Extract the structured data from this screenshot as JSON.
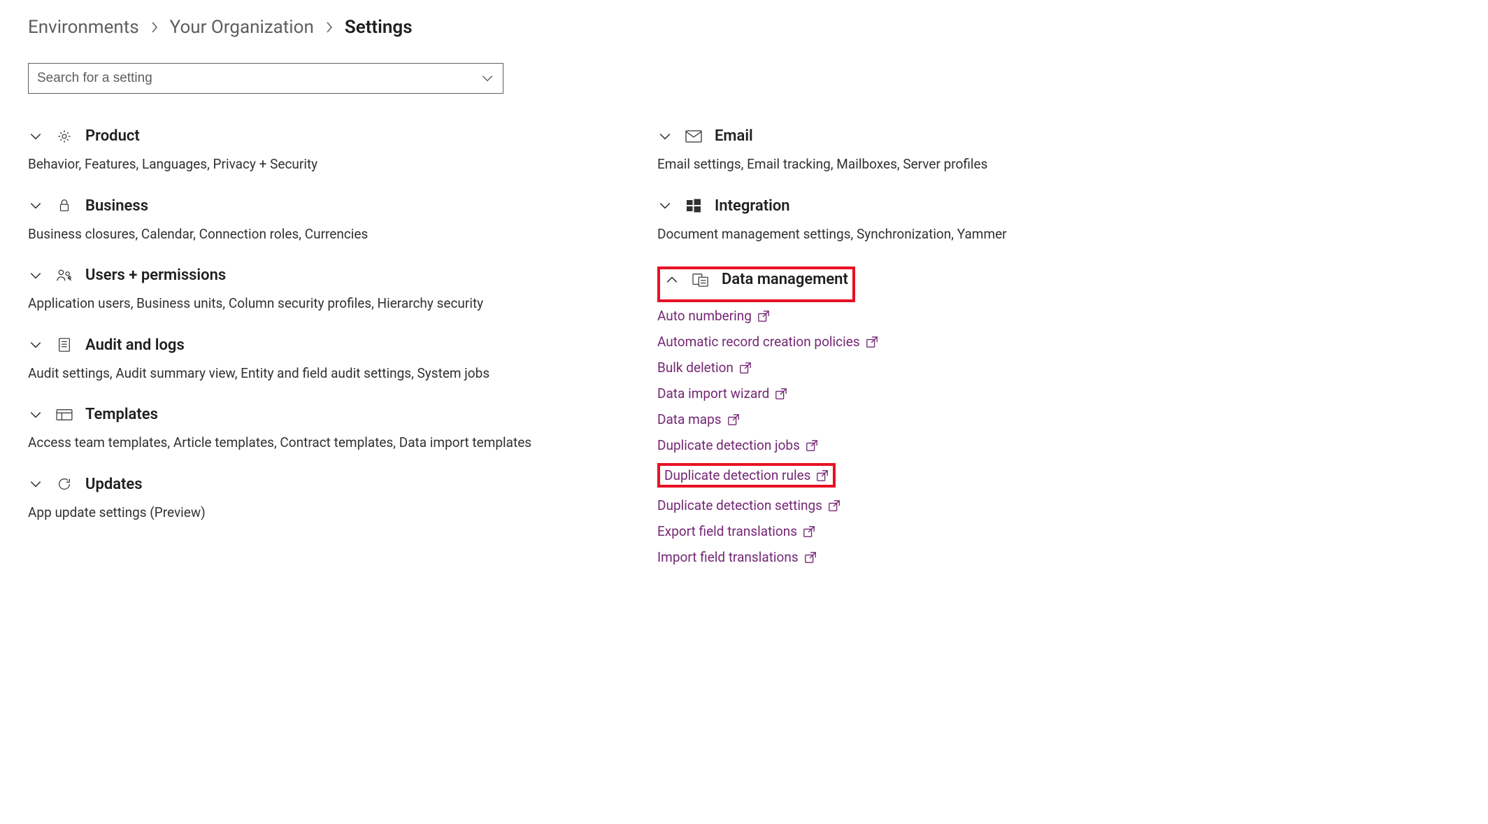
{
  "breadcrumb": {
    "items": [
      {
        "label": "Environments",
        "active": false
      },
      {
        "label": "Your Organization",
        "active": false
      },
      {
        "label": "Settings",
        "active": true
      }
    ]
  },
  "search": {
    "placeholder": "Search for a setting"
  },
  "left_categories": [
    {
      "icon": "gear",
      "title": "Product",
      "expanded": false,
      "description": "Behavior, Features, Languages, Privacy + Security"
    },
    {
      "icon": "lock",
      "title": "Business",
      "expanded": false,
      "description": "Business closures, Calendar, Connection roles, Currencies"
    },
    {
      "icon": "people",
      "title": "Users + permissions",
      "expanded": false,
      "description": "Application users, Business units, Column security profiles, Hierarchy security"
    },
    {
      "icon": "list",
      "title": "Audit and logs",
      "expanded": false,
      "description": "Audit settings, Audit summary view, Entity and field audit settings, System jobs"
    },
    {
      "icon": "templates",
      "title": "Templates",
      "expanded": false,
      "description": "Access team templates, Article templates, Contract templates, Data import templates"
    },
    {
      "icon": "refresh",
      "title": "Updates",
      "expanded": false,
      "description": "App update settings (Preview)"
    }
  ],
  "right_categories": [
    {
      "icon": "mail",
      "title": "Email",
      "expanded": false,
      "description": "Email settings, Email tracking, Mailboxes, Server profiles"
    },
    {
      "icon": "windows",
      "title": "Integration",
      "expanded": false,
      "description": "Document management settings, Synchronization, Yammer"
    },
    {
      "icon": "data",
      "title": "Data management",
      "expanded": true,
      "highlighted": true,
      "links": [
        {
          "label": "Auto numbering",
          "external": true
        },
        {
          "label": "Automatic record creation policies",
          "external": true
        },
        {
          "label": "Bulk deletion",
          "external": true
        },
        {
          "label": "Data import wizard",
          "external": true
        },
        {
          "label": "Data maps",
          "external": true
        },
        {
          "label": "Duplicate detection jobs",
          "external": true
        },
        {
          "label": "Duplicate detection rules",
          "external": true,
          "highlighted": true
        },
        {
          "label": "Duplicate detection settings",
          "external": true
        },
        {
          "label": "Export field translations",
          "external": true
        },
        {
          "label": "Import field translations",
          "external": true
        }
      ]
    }
  ]
}
